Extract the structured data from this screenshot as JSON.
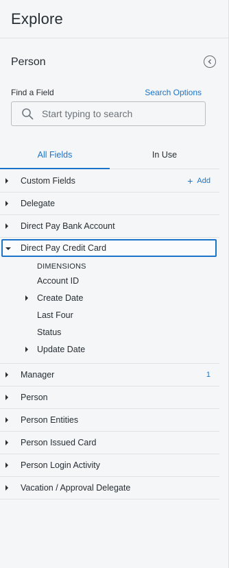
{
  "header": {
    "title": "Explore"
  },
  "panel": {
    "model_title": "Person",
    "find_label": "Find a Field",
    "search_options_label": "Search Options",
    "search_placeholder": "Start typing to search"
  },
  "tabs": [
    {
      "label": "All Fields",
      "active": true
    },
    {
      "label": "In Use",
      "active": false
    }
  ],
  "views_top": [
    {
      "label": "Custom Fields",
      "action": "Add"
    },
    {
      "label": "Delegate"
    },
    {
      "label": "Direct Pay Bank Account"
    }
  ],
  "expanded_view": {
    "label": "Direct Pay Credit Card",
    "group_label": "DIMENSIONS",
    "fields": [
      {
        "label": "Account ID",
        "expandable": false
      },
      {
        "label": "Create Date",
        "expandable": true
      },
      {
        "label": "Last Four",
        "expandable": false
      },
      {
        "label": "Status",
        "expandable": false
      },
      {
        "label": "Update Date",
        "expandable": true
      }
    ]
  },
  "views_bottom": [
    {
      "label": "Manager",
      "count": "1"
    },
    {
      "label": "Person"
    },
    {
      "label": "Person Entities"
    },
    {
      "label": "Person Issued Card"
    },
    {
      "label": "Person Login Activity"
    },
    {
      "label": "Vacation / Approval Delegate"
    }
  ],
  "colors": {
    "accent": "#1a73c8",
    "text": "#262d33",
    "background": "#f5f6f7",
    "divider": "#dfe1e3"
  }
}
